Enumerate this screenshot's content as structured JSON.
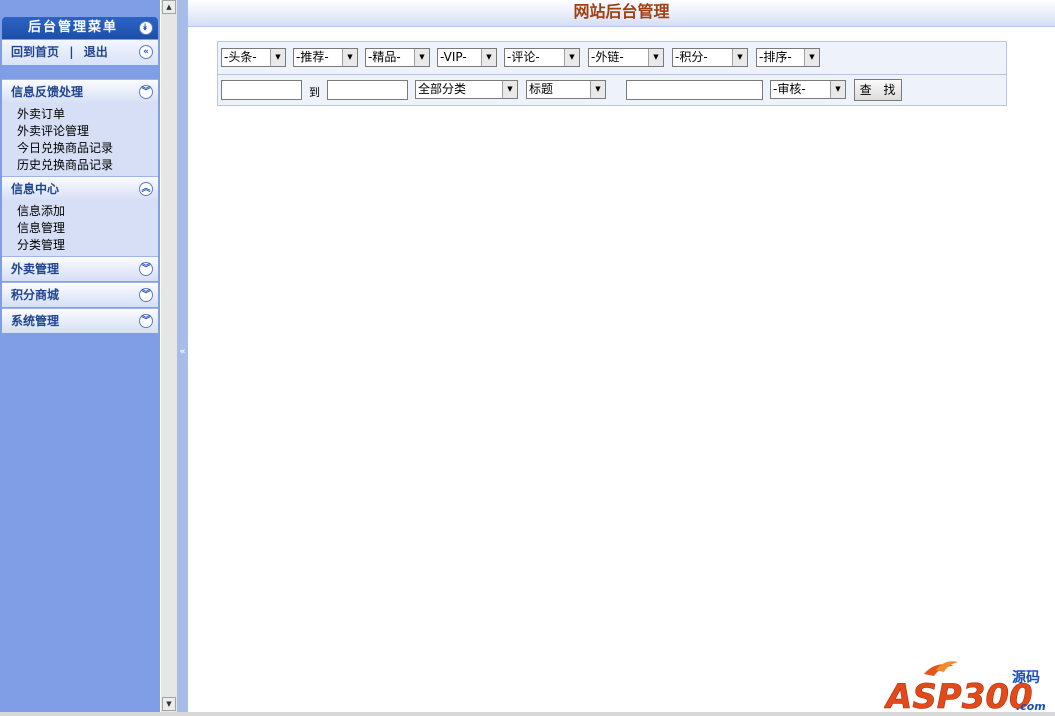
{
  "sidebar": {
    "title": "后台管理菜单",
    "home_link": "回到首页",
    "separator": "|",
    "logout_link": "退出",
    "sections": [
      {
        "label": "信息反馈处理",
        "expanded": true,
        "items": [
          "外卖订单",
          "外卖评论管理",
          "今日兑换商品记录",
          "历史兑换商品记录"
        ]
      },
      {
        "label": "信息中心",
        "expanded": true,
        "items": [
          "信息添加",
          "信息管理",
          "分类管理"
        ]
      },
      {
        "label": "外卖管理",
        "expanded": false,
        "items": []
      },
      {
        "label": "积分商城",
        "expanded": false,
        "items": []
      },
      {
        "label": "系统管理",
        "expanded": false,
        "items": []
      }
    ]
  },
  "header": {
    "title": "网站后台管理"
  },
  "filters": {
    "headline": "-头条-",
    "recommend": "-推荐-",
    "featured": "-精品-",
    "vip": "-VIP-",
    "comment": "-评论-",
    "external_link": "-外链-",
    "points": "-积分-",
    "sort": "-排序-",
    "date_to_label": "到",
    "category": "全部分类",
    "field": "标题",
    "audit": "-审核-",
    "search_button": "查 找"
  },
  "logo": {
    "text": "ASP300",
    "suffix": ".com",
    "chinese": "源码"
  },
  "colors": {
    "sidebar_bg": "#7f9ee6",
    "title_color": "#a13f13",
    "panel_bg": "#eef3fb"
  }
}
